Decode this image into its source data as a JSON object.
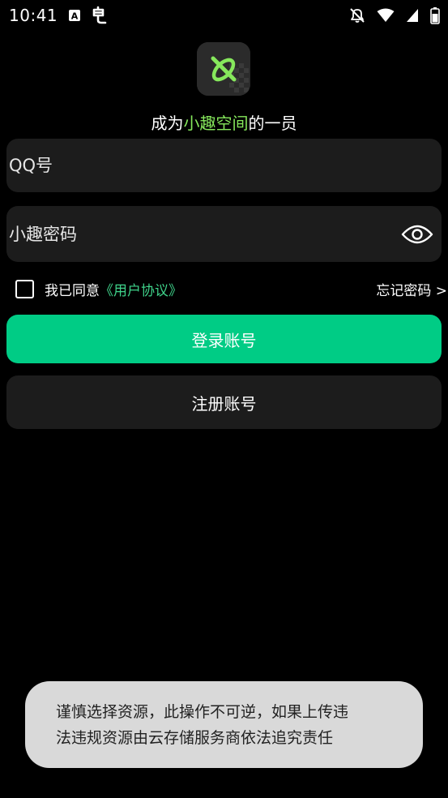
{
  "status_bar": {
    "time": "10:41",
    "left_icons": [
      "font-notification-icon",
      "app-notification-icon"
    ],
    "right_icons": [
      "mute-icon",
      "wifi-icon",
      "signal-icon",
      "battery-icon"
    ]
  },
  "app": {
    "logo_icon": "xiaoqu-logo-icon",
    "tagline_prefix": "成为",
    "tagline_accent": "小趣空间",
    "tagline_suffix": "的一员"
  },
  "form": {
    "qq_placeholder": "QQ号",
    "qq_value": "",
    "password_placeholder": "小趣密码",
    "password_value": "",
    "agree_label": "我已同意",
    "agreement_link": "《用户协议》",
    "forgot_password": "忘记密码 >"
  },
  "buttons": {
    "login": "登录账号",
    "register": "注册账号"
  },
  "toast": {
    "line1": "谨慎选择资源，此操作不可逆，如果上传违",
    "line2": "法违规资源由云存储服务商依法追究责任"
  },
  "colors": {
    "background": "#000000",
    "surface": "#1c1c1c",
    "primary": "#00cc85",
    "accent_text": "#86e85c",
    "link": "#3fd28a",
    "toast_bg": "#d9d9d9"
  }
}
